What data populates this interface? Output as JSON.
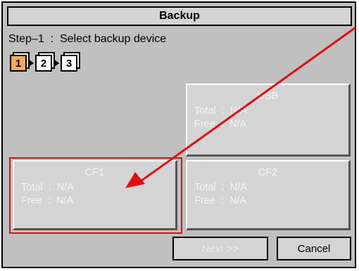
{
  "window": {
    "title": "Backup"
  },
  "step": {
    "instruction": "Step–1  :  Select backup device",
    "indicators": [
      "1",
      "2",
      "3"
    ],
    "current": 1
  },
  "devices": [
    {
      "name": "USB",
      "total": "Total  :  N/A",
      "free": "Free  :  N/A",
      "selected": false
    },
    {
      "name": "CF1",
      "total": "Total  :  N/A",
      "free": "Free  :  N/A",
      "selected": true
    },
    {
      "name": "CF2",
      "total": "Total  :  N/A",
      "free": "Free  :  N/A",
      "selected": false
    }
  ],
  "buttons": {
    "next_label": "Next  >>",
    "cancel_label": "Cancel"
  },
  "colors": {
    "active_step": "#f4a85c",
    "selection": "#e01010",
    "annotation_arrow": "#e01010"
  }
}
